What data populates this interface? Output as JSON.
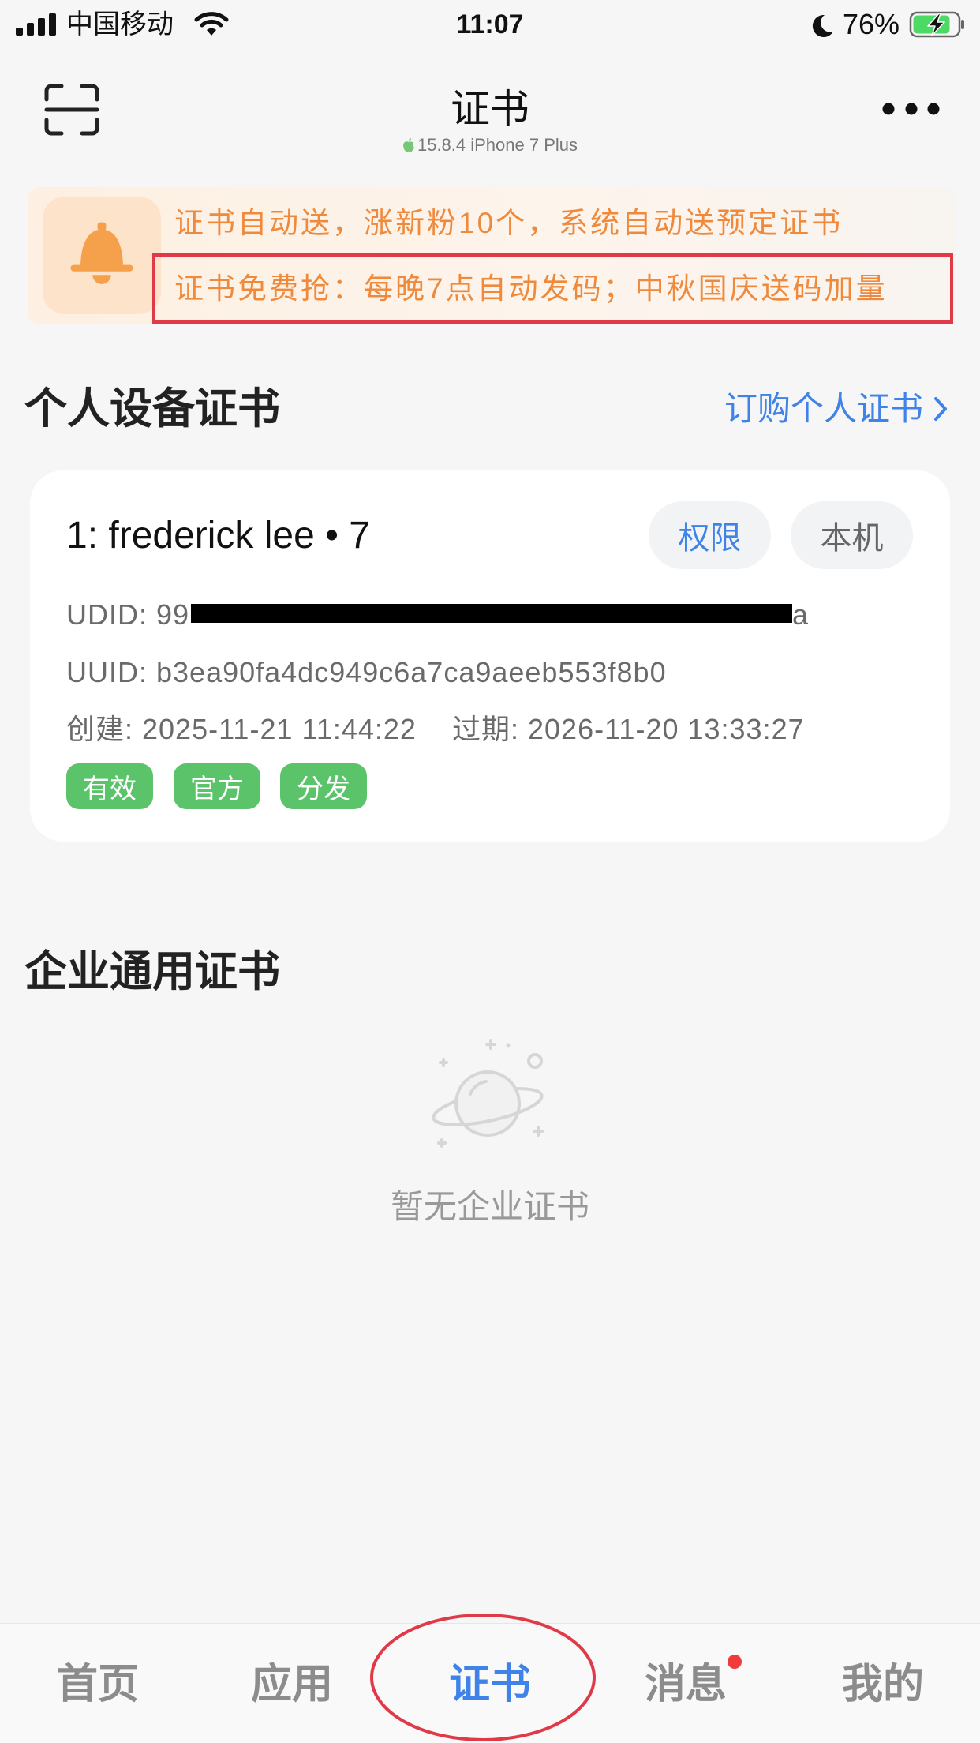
{
  "status_bar": {
    "carrier": "中国移动",
    "time": "11:07",
    "battery": "76%"
  },
  "nav": {
    "title": "证书",
    "subtitle": "15.8.4 iPhone 7 Plus"
  },
  "notice": {
    "lines": [
      "证书自动送，涨新粉10个，系统自动送预定证书",
      "证书免费抢：每晚7点自动发码；中秋国庆送码加量"
    ]
  },
  "personal": {
    "title": "个人设备证书",
    "link": "订购个人证书",
    "certs": [
      {
        "name": "1: frederick lee • 7",
        "permission_btn": "权限",
        "local_btn": "本机",
        "udid_visible": "UDID: 99",
        "udid_tail": "a",
        "uuid": "UUID: b3ea90fa4dc949c6a7ca9aeeb553f8b0",
        "created": "创建: 2025-11-21 11:44:22",
        "expires": "过期: 2026-11-20 13:33:27",
        "tags": [
          "有效",
          "官方",
          "分发"
        ]
      }
    ]
  },
  "enterprise": {
    "title": "企业通用证书",
    "empty_text": "暂无企业证书"
  },
  "tabbar": {
    "active": "证书",
    "items": [
      {
        "label": "首页"
      },
      {
        "label": "应用"
      },
      {
        "label": "证书"
      },
      {
        "label": "消息",
        "badge": true
      },
      {
        "label": "我的"
      }
    ]
  },
  "colors": {
    "accent": "#3f83e8",
    "notice": "#ef8a3d",
    "tag": "#5bc46a",
    "annot": "#e03a48",
    "badge": "#ef3b3b"
  },
  "icons": [
    "signal-icon",
    "wifi-icon",
    "moon-icon",
    "battery-icon",
    "scan-icon",
    "apple-icon",
    "more-icon",
    "bell-icon",
    "chevron-right-icon",
    "planet-icon"
  ]
}
